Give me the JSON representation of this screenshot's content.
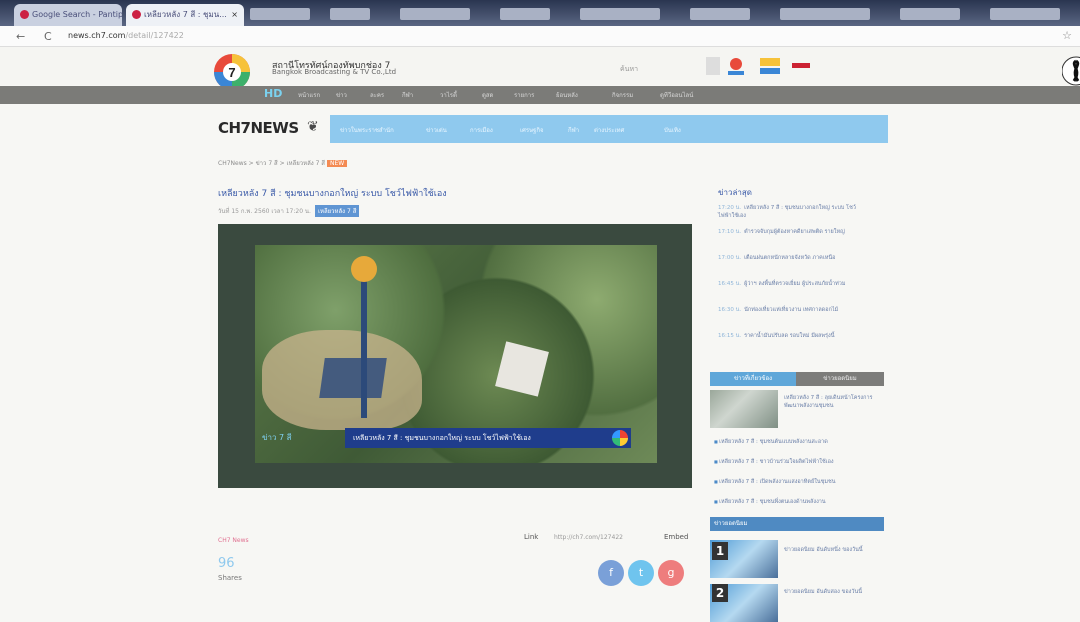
{
  "browser": {
    "tabs": [
      {
        "label": "Google Search - Pantip",
        "close": ""
      },
      {
        "label": "เหลียวหลัง 7 สี : ชุมน...",
        "close": "×"
      }
    ],
    "back": "←",
    "reload": "C",
    "url": "news.ch7.com",
    "url_rest": "/detail/127422",
    "star": "☆"
  },
  "site": {
    "brand_th": "สถานีโทรทัศน์กองทัพบกช่อง 7",
    "brand_en": "Bangkok Broadcasting & TV Co.,Ltd",
    "search_placeholder": "ค้นหา",
    "hd": "HD",
    "topnav": [
      "หน้าแรก",
      "ข่าว",
      "ละคร",
      "กีฬา",
      "วาไรตี้",
      "ดูสด",
      "รายการ",
      "ย้อนหลัง",
      "กิจกรรม",
      "ดูทีวีออนไลน์"
    ],
    "news_logo": "CH7NEWS",
    "newsnav": [
      "ข่าวในพระราชสำนัก",
      "ข่าวเด่น",
      "การเมือง",
      "เศรษฐกิจ",
      "กีฬา",
      "ต่างประเทศ",
      "บันเทิง"
    ]
  },
  "breadcrumb": {
    "path": "CH7News > ข่าว 7 สี > เหลียวหลัง 7 สี",
    "badge": "NEW"
  },
  "article": {
    "headline": "เหลียวหลัง 7 สี : ชุมชนบางกอกใหญ่ ระบบ โชว์ไฟฟ้าใช้เอง",
    "meta": "วันที่ 15 ก.พ. 2560 เวลา 17:20 น.",
    "tag": "เหลียวหลัง 7 สี",
    "lower_third": "เหลียวหลัง 7 สี : ชุมชนบางกอกใหญ่ ระบบ โชว์ไฟฟ้าใช้เอง",
    "lower_logo": "ข่าว 7 สี",
    "source": "CH7 News",
    "link_label": "Link",
    "link_value": "http://ch7.com/127422",
    "embed_label": "Embed",
    "shares": "96",
    "shares_label": "Shares"
  },
  "sidebar": {
    "latest_title": "ข่าวล่าสุด",
    "latest": [
      {
        "time": "17:20 น.",
        "text": "เหลียวหลัง 7 สี : ชุมชนบางกอกใหญ่ ระบบ โชว์ไฟฟ้าใช้เอง"
      },
      {
        "time": "17:10 น.",
        "text": "ตำรวจจับกุมผู้ต้องหาคดียาเสพติด รายใหญ่"
      },
      {
        "time": "17:00 น.",
        "text": "เตือนฝนตกหนักหลายจังหวัด ภาคเหนือ"
      },
      {
        "time": "16:45 น.",
        "text": "ผู้ว่าฯ ลงพื้นที่ตรวจเยี่ยม ผู้ประสบภัยน้ำท่วม"
      },
      {
        "time": "16:30 น.",
        "text": "นักท่องเที่ยวแห่เที่ยวงาน เทศกาลดอกไม้"
      },
      {
        "time": "16:15 น.",
        "text": "ราคาน้ำมันปรับลด รอบใหม่ มีผลพรุ่งนี้"
      }
    ],
    "tab_a": "ข่าวที่เกี่ยวข้อง",
    "tab_b": "ข่าวยอดนิยม",
    "related_lead": "เหลียวหลัง 7 สี : ลุยเดินหน้าโครงการพัฒนาพลังงานชุมชน",
    "related": [
      "เหลียวหลัง 7 สี : ชุมชนต้นแบบพลังงานสะอาด",
      "เหลียวหลัง 7 สี : ชาวบ้านร่วมใจผลิตไฟฟ้าใช้เอง",
      "เหลียวหลัง 7 สี : เปิดพลังงานแสงอาทิตย์ในชุมชน",
      "เหลียวหลัง 7 สี : ชุมชนพึ่งตนเองด้านพลังงาน"
    ],
    "popular_title": "ข่าวยอดนิยม",
    "popular": [
      {
        "num": "1",
        "text": "ข่าวยอดนิยม อันดับหนึ่ง ของวันนี้"
      },
      {
        "num": "2",
        "text": "ข่าวยอดนิยม อันดับสอง ของวันนี้"
      }
    ]
  }
}
